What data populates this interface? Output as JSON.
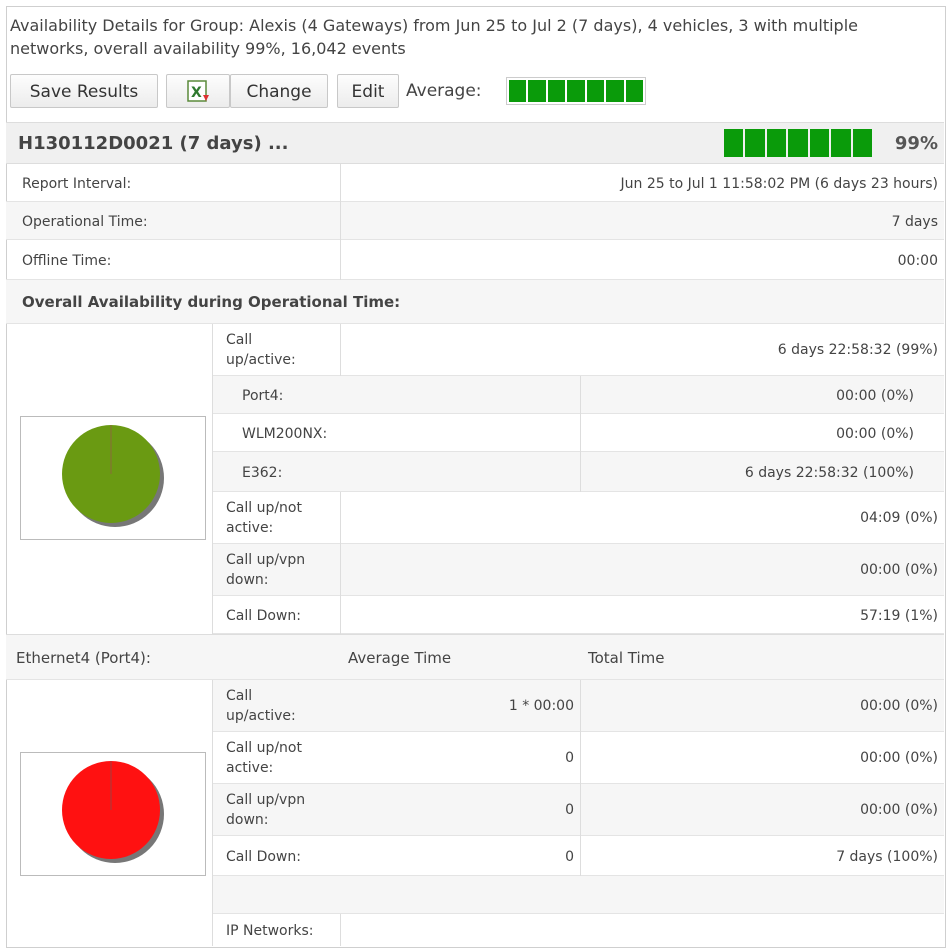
{
  "header": {
    "caption": "Availability Details for Group: Alexis (4 Gateways) from Jun 25 to Jul 2 (7 days), 4 vehicles, 3 with multiple networks, overall availability 99%, 16,042 events"
  },
  "toolbar": {
    "save_label": "Save Results",
    "excel_icon": "excel-export-icon",
    "change_label": "Change",
    "edit_label": "Edit",
    "average_label": "Average:",
    "average_value": 1.0,
    "bar_color": "#0a9b0a"
  },
  "gateway": {
    "name": "H130112D0021 (7 days) ...",
    "availability_pct": "99%",
    "report_interval_label": "Report Interval:",
    "report_interval_value": "Jun 25 to Jul 1 11:58:02 PM (6 days 23 hours)",
    "operational_time_label": "Operational Time:",
    "operational_time_value": "7 days",
    "offline_time_label": "Offline Time:",
    "offline_time_value": "00:00"
  },
  "overall": {
    "title": "Overall Availability during Operational Time:",
    "pie_color": "#6a9a12",
    "rows": {
      "call_up_active": {
        "label_1": "Call",
        "label_2": "up/active:",
        "value": "6 days 22:58:32 (99%)"
      },
      "port4": {
        "label": "Port4:",
        "value": "00:00 (0%)"
      },
      "wlm": {
        "label": "WLM200NX:",
        "value": "00:00 (0%)"
      },
      "e362": {
        "label": "E362:",
        "value": "6 days 22:58:32 (100%)"
      },
      "call_up_not_active": {
        "label_1": "Call up/not",
        "label_2": "active:",
        "value": "04:09 (0%)"
      },
      "call_up_vpn_down": {
        "label_1": "Call up/vpn",
        "label_2": "down:",
        "value": "00:00 (0%)"
      },
      "call_down": {
        "label": "Call Down:",
        "value": "57:19 (1%)"
      }
    }
  },
  "ethernet": {
    "title": "Ethernet4 (Port4):",
    "col_avg": "Average Time",
    "col_total": "Total Time",
    "pie_color": "#ff1111",
    "rows": {
      "call_up_active": {
        "label_1": "Call",
        "label_2": "up/active:",
        "avg": "1 * 00:00",
        "total": "00:00 (0%)"
      },
      "call_up_not_active": {
        "label_1": "Call up/not",
        "label_2": "active:",
        "avg": "0",
        "total": "00:00 (0%)"
      },
      "call_up_vpn_down": {
        "label_1": "Call up/vpn",
        "label_2": "down:",
        "avg": "0",
        "total": "00:00 (0%)"
      },
      "call_down": {
        "label": "Call Down:",
        "avg": "0",
        "total": "7 days (100%)"
      }
    },
    "ip_networks_label": "IP Networks:"
  }
}
